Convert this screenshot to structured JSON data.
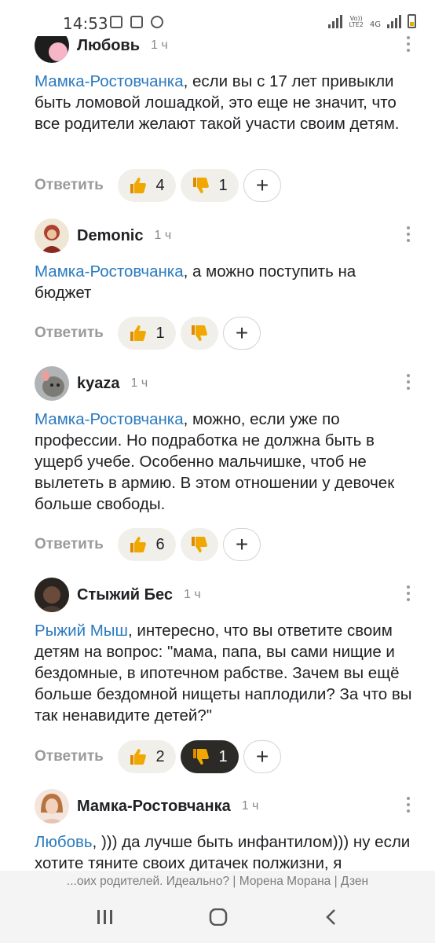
{
  "status_bar": {
    "time": "14:53",
    "net_label_top": "Vo))",
    "net_label_bottom": "LTE2",
    "net_gen": "4G"
  },
  "reply_label": "Ответить",
  "comments": [
    {
      "author": "Любовь",
      "time": "1 ч",
      "mention": "Мамка-Ростовчанка",
      "text": ", если вы с 17 лет привыкли быть ломовой лошадкой, это еще не значит, что все родители желают такой участи своим детям.",
      "likes": "4",
      "dislikes": "1"
    },
    {
      "author": "Demonic",
      "time": "1 ч",
      "mention": "Мамка-Ростовчанка",
      "text": ", а можно поступить на бюджет",
      "likes": "1",
      "dislikes": ""
    },
    {
      "author": "kyaza",
      "time": "1 ч",
      "mention": "Мамка-Ростовчанка",
      "text": ", можно, если уже по профессии. Но подработка не должна быть в ущерб учебе. Особенно мальчишке, чтоб не вылететь в армию. В этом отношении у девочек больше свободы.",
      "likes": "6",
      "dislikes": ""
    },
    {
      "author": "Стыжий Бес",
      "time": "1 ч",
      "mention": "Рыжий Мыш",
      "text": ", интересно, что вы ответите своим детям на вопрос: \"мама, папа, вы сами нищие и бездомные, в ипотечном рабстве. Зачем вы ещё больше бездомной нищеты наплодили? За что вы так ненавидите детей?\"",
      "likes": "2",
      "dislikes": "1"
    },
    {
      "author": "Мамка-Ростовчанка",
      "time": "1 ч",
      "mention": "Любовь",
      "text": ", ))) да лучше быть инфантилом))) ну если хотите тяните своих дитачек полжизни, я",
      "likes": "",
      "dislikes": ""
    }
  ],
  "footer_caption": "...оих родителей. Идеально? | Морена Морана | Дзен",
  "colors": {
    "mention": "#2a7abf",
    "pill_bg": "#f1efea",
    "pill_active_bg": "#2b2a26",
    "thumb": "#f0a800"
  }
}
